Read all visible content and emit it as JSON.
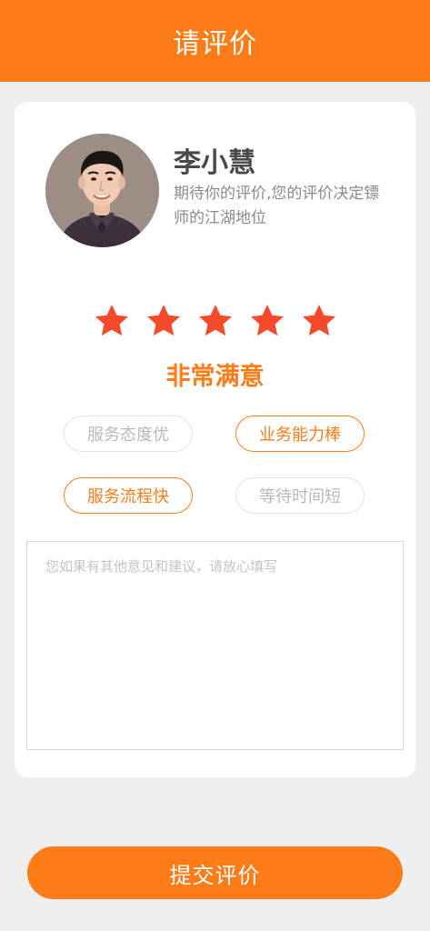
{
  "header": {
    "title": "请评价"
  },
  "profile": {
    "name": "李小慧",
    "subtitle": "期待你的评价,您的评价决定镖师的江湖地位"
  },
  "rating": {
    "stars_filled": 5,
    "stars_total": 5,
    "label": "非常满意",
    "star_color": "#f5492b"
  },
  "tags": [
    {
      "label": "服务态度优",
      "selected": false
    },
    {
      "label": "业务能力棒",
      "selected": true
    },
    {
      "label": "服务流程快",
      "selected": true
    },
    {
      "label": "等待时间短",
      "selected": false
    }
  ],
  "comment": {
    "placeholder": "您如果有其他意见和建议，请放心填写",
    "value": ""
  },
  "submit": {
    "label": "提交评价"
  },
  "colors": {
    "accent": "#fd7c18",
    "background": "#efefef"
  }
}
